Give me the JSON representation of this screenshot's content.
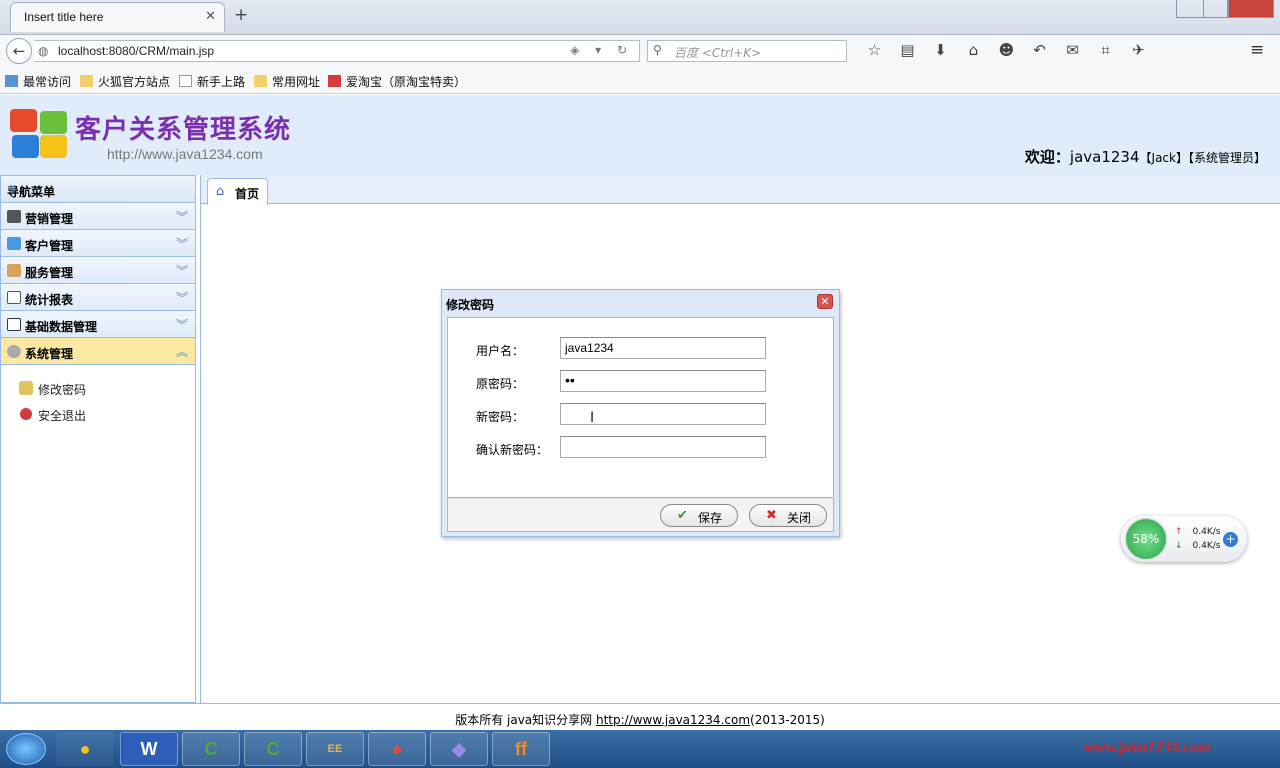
{
  "browser": {
    "tab_title": "Insert title here",
    "tab_close_icon": "close-icon",
    "new_tab_label": "+",
    "url": "localhost:8080/CRM/main.jsp",
    "search_placeholder": "百度 <Ctrl+K>",
    "bookmarks": [
      "最常访问",
      "火狐官方站点",
      "新手上路",
      "常用网址",
      "爱淘宝（原淘宝特卖）"
    ]
  },
  "header": {
    "title": "客户关系管理系统",
    "url": "http://www.java1234.com",
    "welcome_prefix": "欢迎：",
    "username": "java1234",
    "user_real": "【Jack】",
    "user_role": "【系统管理员】"
  },
  "sidebar": {
    "title": "导航菜单",
    "menus": [
      "营销管理",
      "客户管理",
      "服务管理",
      "统计报表",
      "基础数据管理",
      "系统管理"
    ],
    "active_menu": "系统管理",
    "subitems": [
      "修改密码",
      "安全退出"
    ]
  },
  "main": {
    "tab_label": "首页"
  },
  "dialog": {
    "title": "修改密码",
    "fields": [
      {
        "label": "用户名：",
        "value": "java1234"
      },
      {
        "label": "原密码：",
        "value": "••"
      },
      {
        "label": "新密码：",
        "value": ""
      },
      {
        "label": "确认新密码：",
        "value": ""
      }
    ],
    "save_label": "保存",
    "close_label": "关闭"
  },
  "footer": {
    "text": "版本所有 java知识分享网 ",
    "link": "http://www.java1234.com",
    "years": "(2013-2015)"
  },
  "net_widget": {
    "percent": "58%",
    "up_speed": "0.4K/s",
    "down_speed": "0.4K/s"
  },
  "taskbar": {
    "apps": [
      "W",
      "C",
      "C",
      "EE",
      "●",
      "◆",
      "ff"
    ],
    "watermark": "www.java1234.com"
  },
  "colors": {
    "header_bg": "#e1ecfb",
    "title_purple": "#7b2fb0",
    "active_menu_bg": "#fbe9a2",
    "panel_border": "#99bbe8"
  }
}
